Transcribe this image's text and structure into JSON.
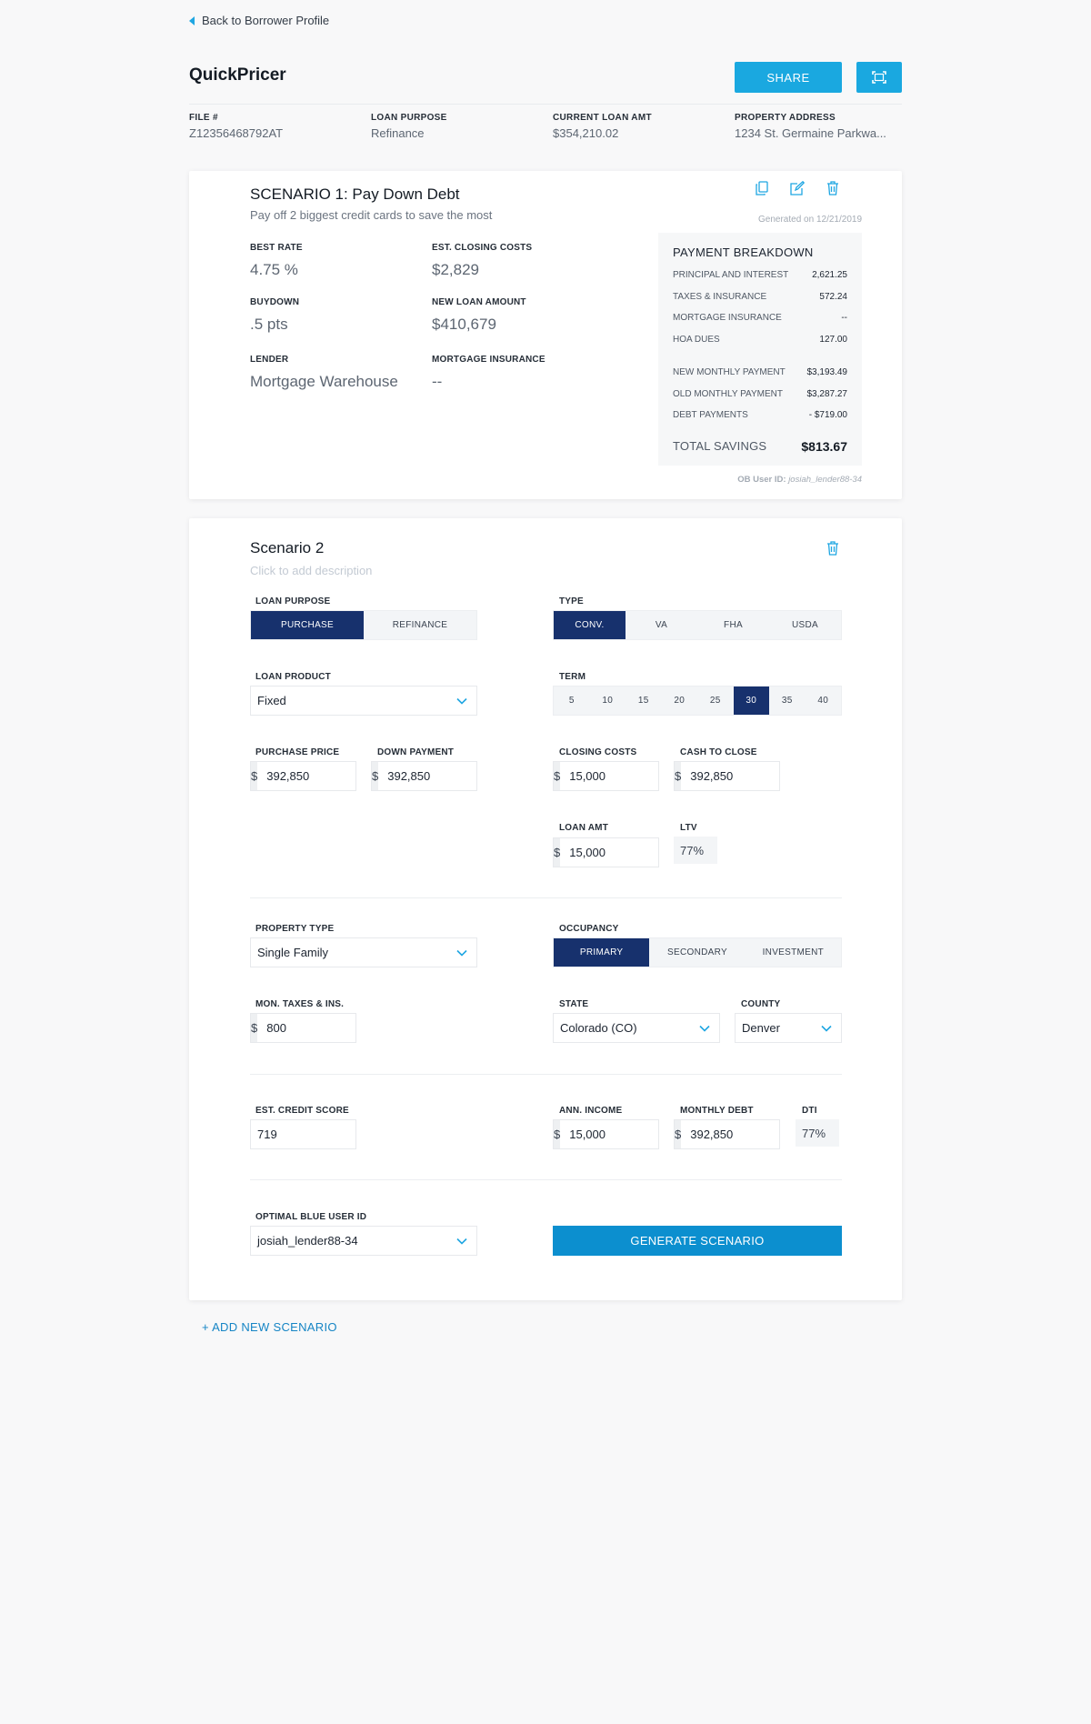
{
  "nav": {
    "back_label": "Back to Borrower Profile"
  },
  "header": {
    "title": "QuickPricer",
    "share_label": "SHARE",
    "fields": [
      {
        "label": "FILE #",
        "value": "Z12356468792AT"
      },
      {
        "label": "LOAN PURPOSE",
        "value": "Refinance"
      },
      {
        "label": "CURRENT LOAN AMT",
        "value": "$354,210.02"
      },
      {
        "label": "PROPERTY ADDRESS",
        "value": "1234 St. Germaine Parkwa..."
      }
    ]
  },
  "scenario1": {
    "title": "SCENARIO 1: Pay Down Debt",
    "description": "Pay off 2 biggest credit cards to save the most",
    "generated": "Generated on 12/21/2019",
    "fields": {
      "best_rate": {
        "label": "BEST RATE",
        "value": "4.75 %"
      },
      "closing_costs": {
        "label": "EST. CLOSING COSTS",
        "value": "$2,829"
      },
      "buydown": {
        "label": "BUYDOWN",
        "value": ".5 pts"
      },
      "new_loan": {
        "label": "NEW LOAN AMOUNT",
        "value": "$410,679"
      },
      "lender": {
        "label": "LENDER",
        "value": "Mortgage Warehouse"
      },
      "mortgage_insurance": {
        "label": "MORTGAGE INSURANCE",
        "value": "--"
      }
    },
    "breakdown": {
      "title": "PAYMENT BREAKDOWN",
      "rows": [
        {
          "label": "PRINCIPAL AND INTEREST",
          "value": "2,621.25"
        },
        {
          "label": "TAXES & INSURANCE",
          "value": "572.24"
        },
        {
          "label": "MORTGAGE INSURANCE",
          "value": "--"
        },
        {
          "label": "HOA DUES",
          "value": "127.00"
        }
      ],
      "rows2": [
        {
          "label": "NEW MONTHLY PAYMENT",
          "value": "$3,193.49"
        },
        {
          "label": "OLD MONTHLY PAYMENT",
          "value": "$3,287.27"
        },
        {
          "label": "DEBT PAYMENTS",
          "value": "- $719.00"
        }
      ],
      "total_label": "TOTAL SAVINGS",
      "total_value": "$813.67"
    },
    "ob_user_label": "OB User ID:",
    "ob_user_value": "josiah_lender88-34"
  },
  "scenario2": {
    "title": "Scenario 2",
    "description_placeholder": "Click to add description",
    "loan_purpose": {
      "label": "LOAN PURPOSE",
      "options": [
        "PURCHASE",
        "REFINANCE"
      ],
      "selected": "PURCHASE"
    },
    "type": {
      "label": "TYPE",
      "options": [
        "CONV.",
        "VA",
        "FHA",
        "USDA"
      ],
      "selected": "CONV."
    },
    "loan_product": {
      "label": "LOAN PRODUCT",
      "value": "Fixed"
    },
    "term": {
      "label": "TERM",
      "options": [
        "5",
        "10",
        "15",
        "20",
        "25",
        "30",
        "35",
        "40"
      ],
      "selected": "30"
    },
    "purchase_price": {
      "label": "PURCHASE PRICE",
      "currency": "$",
      "value": "392,850"
    },
    "down_payment": {
      "label": "DOWN PAYMENT",
      "currency": "$",
      "value": "392,850"
    },
    "closing_costs": {
      "label": "CLOSING COSTS",
      "currency": "$",
      "value": "15,000"
    },
    "cash_to_close": {
      "label": "CASH TO CLOSE",
      "currency": "$",
      "value": "392,850"
    },
    "loan_amt": {
      "label": "LOAN AMT",
      "currency": "$",
      "value": "15,000"
    },
    "ltv": {
      "label": "LTV",
      "value": "77%"
    },
    "property_type": {
      "label": "PROPERTY TYPE",
      "value": "Single Family"
    },
    "occupancy": {
      "label": "OCCUPANCY",
      "options": [
        "PRIMARY",
        "SECONDARY",
        "INVESTMENT"
      ],
      "selected": "PRIMARY"
    },
    "mon_taxes": {
      "label": "MON. TAXES & INS.",
      "currency": "$",
      "value": "800"
    },
    "state": {
      "label": "STATE",
      "value": "Colorado (CO)"
    },
    "county": {
      "label": "COUNTY",
      "value": "Denver"
    },
    "credit_score": {
      "label": "EST. CREDIT SCORE",
      "value": "719"
    },
    "ann_income": {
      "label": "ANN. INCOME",
      "currency": "$",
      "value": "15,000"
    },
    "monthly_debt": {
      "label": "MONTHLY DEBT",
      "currency": "$",
      "value": "392,850"
    },
    "dti": {
      "label": "DTI",
      "value": "77%"
    },
    "ob_user": {
      "label": "OPTIMAL BLUE USER ID",
      "value": "josiah_lender88-34"
    },
    "generate_label": "GENERATE SCENARIO"
  },
  "add_scenario_label": "+ ADD NEW SCENARIO",
  "colors": {
    "accent": "#1aa8e0",
    "navy": "#17316d",
    "generate": "#0c8fcf",
    "background": "#f8f8f9"
  },
  "icons": [
    "chevron-left-icon",
    "fullscreen-icon",
    "copy-icon",
    "edit-icon",
    "trash-icon",
    "chevron-down-icon"
  ]
}
